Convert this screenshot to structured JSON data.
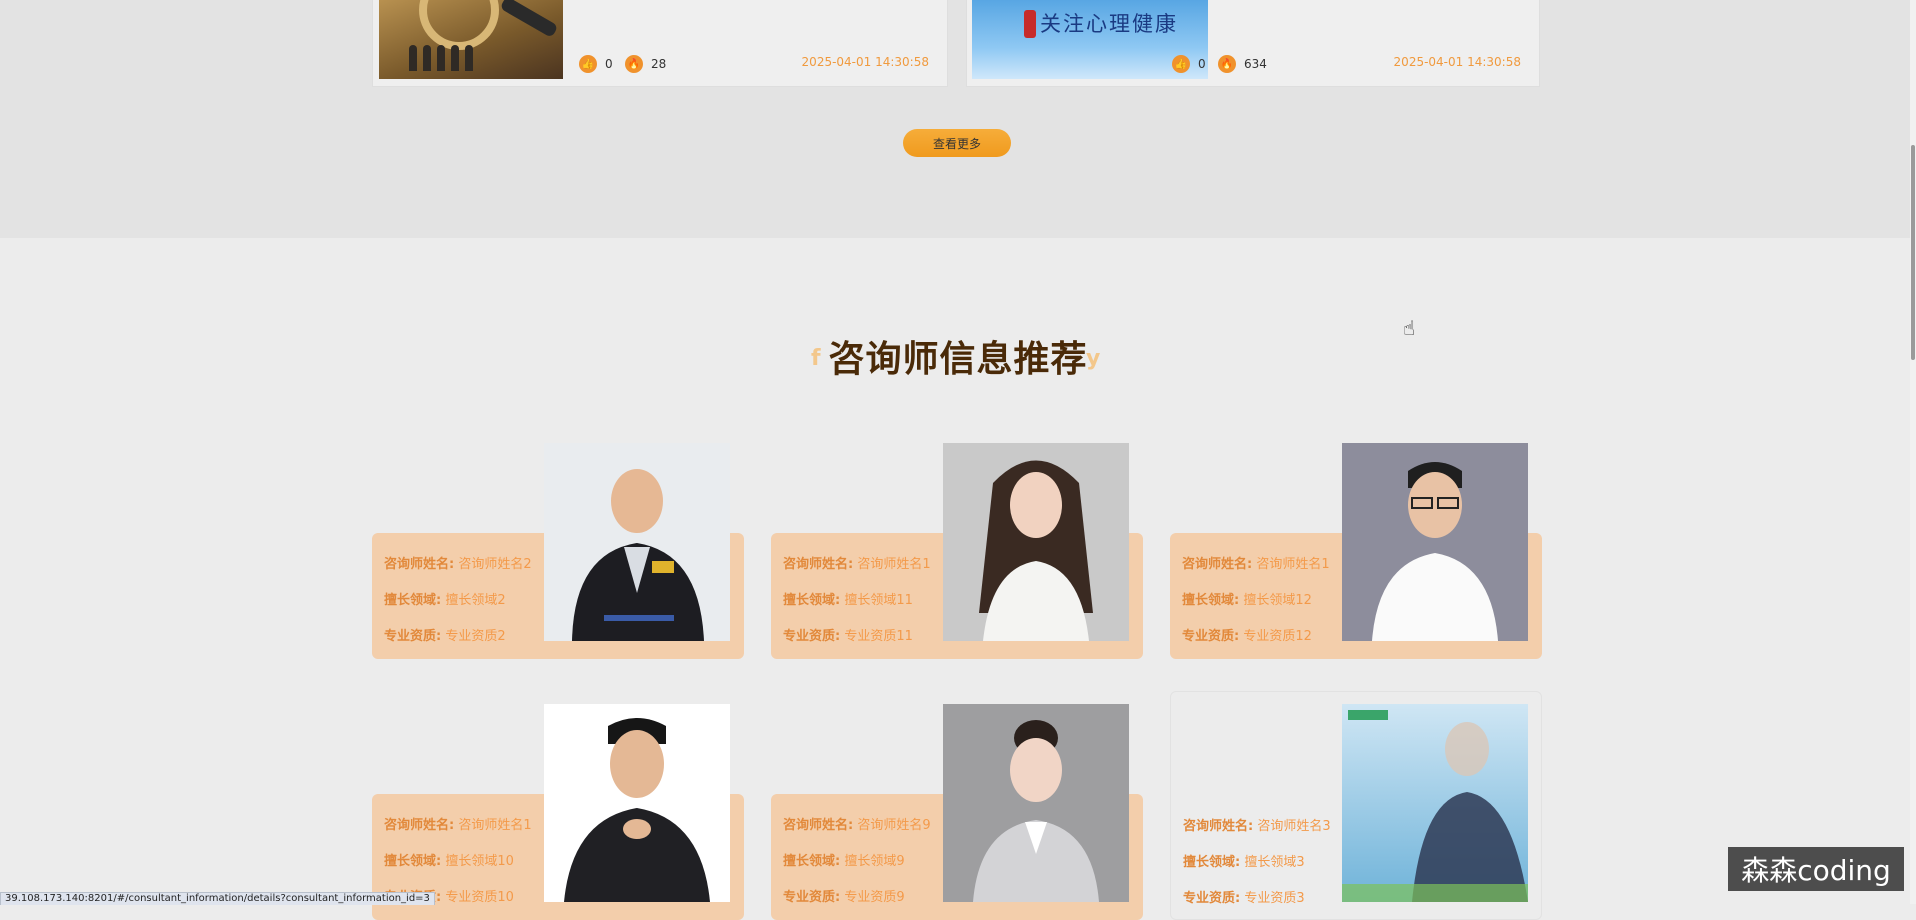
{
  "articles": [
    {
      "likes": "0",
      "hot": "28",
      "date": "2025-04-01 14:30:58"
    },
    {
      "likes": "0",
      "hot": "634",
      "date": "2025-04-01 14:30:58",
      "thumb_text": "关注心理健康"
    }
  ],
  "more_button": "查看更多",
  "section": {
    "title": "咨询师信息推荐",
    "ghost_left": "f",
    "ghost_right": "y"
  },
  "labels": {
    "name": "咨询师姓名:",
    "field": "擅长领域:",
    "qual": "专业资质:"
  },
  "consultants": [
    {
      "name": "咨询师姓名2",
      "field": "擅长领域2",
      "qual": "专业资质2"
    },
    {
      "name": "咨询师姓名1",
      "field": "擅长领域11",
      "qual": "专业资质11"
    },
    {
      "name": "咨询师姓名1",
      "field": "擅长领域12",
      "qual": "专业资质12"
    },
    {
      "name": "咨询师姓名1",
      "field": "擅长领域10",
      "qual": "专业资质10"
    },
    {
      "name": "咨询师姓名9",
      "field": "擅长领域9",
      "qual": "专业资质9"
    },
    {
      "name": "咨询师姓名3",
      "field": "擅长领域3",
      "qual": "专业资质3"
    }
  ],
  "status_url": "39.108.173.140:8201/#/consultant_information/details?consultant_information_id=3",
  "watermark": "森森coding",
  "colors": {
    "accent": "#f09a1e",
    "label": "#e2893b",
    "card": "#f3ceab",
    "title": "#4a2a08"
  }
}
